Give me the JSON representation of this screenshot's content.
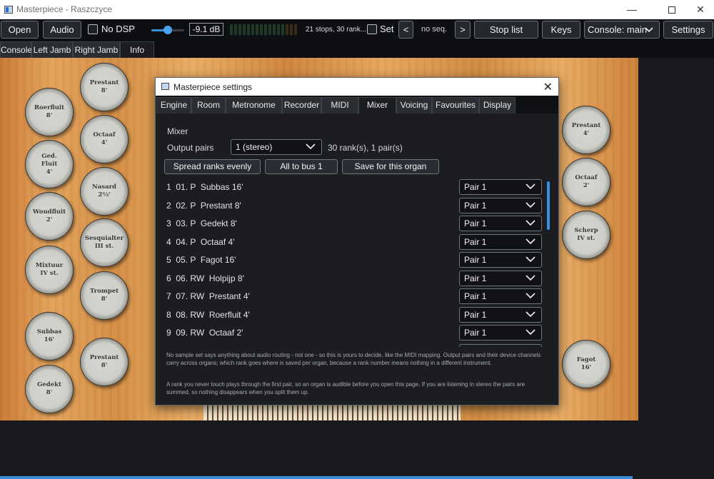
{
  "window": {
    "title": "Masterpiece - Raszczyce"
  },
  "toolbar": {
    "open": "Open",
    "audio": "Audio",
    "no_dsp": "No DSP",
    "volume_db": "-9.1 dB",
    "volume_fraction": 0.45,
    "stops_info": "21 stops, 30 rank...",
    "set": "Set",
    "prev": "<",
    "seq": "no seq.",
    "next": ">",
    "stop_list": "Stop list",
    "keys": "Keys",
    "console": "Console: main",
    "settings": "Settings"
  },
  "main_tabs": [
    "Console",
    "Left Jamb",
    "Right Jamb",
    "Info"
  ],
  "stops_left": [
    {
      "label": "Roerfluit\n8'"
    },
    {
      "label": "Ged. Fluit\n4'"
    },
    {
      "label": "Woudfluit\n2'"
    },
    {
      "label": "Mixtuur\nIV st."
    },
    {
      "label": "Subbas\n16'"
    },
    {
      "label": "Gedekt\n8'"
    },
    {
      "label": "Prestant\n8'"
    },
    {
      "label": "Octaaf\n4'"
    },
    {
      "label": "Nasard\n2⅔'"
    },
    {
      "label": "Sesquialter\nIII st."
    },
    {
      "label": "Trompet\n8'"
    },
    {
      "label": "Prestant\n8'"
    }
  ],
  "stops_right": [
    {
      "label": "Prestant\n4'"
    },
    {
      "label": "Octaaf\n2'"
    },
    {
      "label": "Scherp\nIV st."
    },
    {
      "label": "Fagot\n16'"
    }
  ],
  "dialog": {
    "title": "Masterpiece settings",
    "tabs": [
      "Engine",
      "Room",
      "Metronome",
      "Recorder",
      "MIDI",
      "Mixer",
      "Voicing",
      "Favourites",
      "Display"
    ],
    "active_tab": "Mixer",
    "section": "Mixer",
    "output_pairs_label": "Output pairs",
    "output_pairs_value": "1 (stereo)",
    "pairs_info": "30 rank(s), 1 pair(s)",
    "buttons": {
      "spread": "Spread ranks evenly",
      "all_bus": "All to bus 1",
      "save": "Save for this organ"
    },
    "ranks": [
      {
        "num": "1",
        "name": "01. P  Subbas 16'",
        "pair": "Pair 1"
      },
      {
        "num": "2",
        "name": "02. P  Prestant 8'",
        "pair": "Pair 1"
      },
      {
        "num": "3",
        "name": "03. P  Gedekt 8'",
        "pair": "Pair 1"
      },
      {
        "num": "4",
        "name": "04. P  Octaaf 4'",
        "pair": "Pair 1"
      },
      {
        "num": "5",
        "name": "05. P  Fagot 16'",
        "pair": "Pair 1"
      },
      {
        "num": "6",
        "name": "06. RW  Holpijp 8'",
        "pair": "Pair 1"
      },
      {
        "num": "7",
        "name": "07. RW  Prestant 4'",
        "pair": "Pair 1"
      },
      {
        "num": "8",
        "name": "08. RW  Roerfluit 4'",
        "pair": "Pair 1"
      },
      {
        "num": "9",
        "name": "09. RW  Octaaf 2'",
        "pair": "Pair 1"
      }
    ],
    "note1": "No sample set says anything about audio routing - not one - so this is yours to decide, like the MIDI mapping. Output pairs and their device channels carry across organs; which rank goes where is saved per organ, because a rank number means nothing in a different instrument.",
    "note2": "A rank you never touch plays through the first pair, so an organ is audible before you open this page. If you are listening in stereo the pairs are summed, so nothing disappears when you split them up."
  },
  "colors": {
    "accent": "#3a8fd6",
    "wood": "#e0a05a",
    "dark_bg": "#181a1e"
  }
}
